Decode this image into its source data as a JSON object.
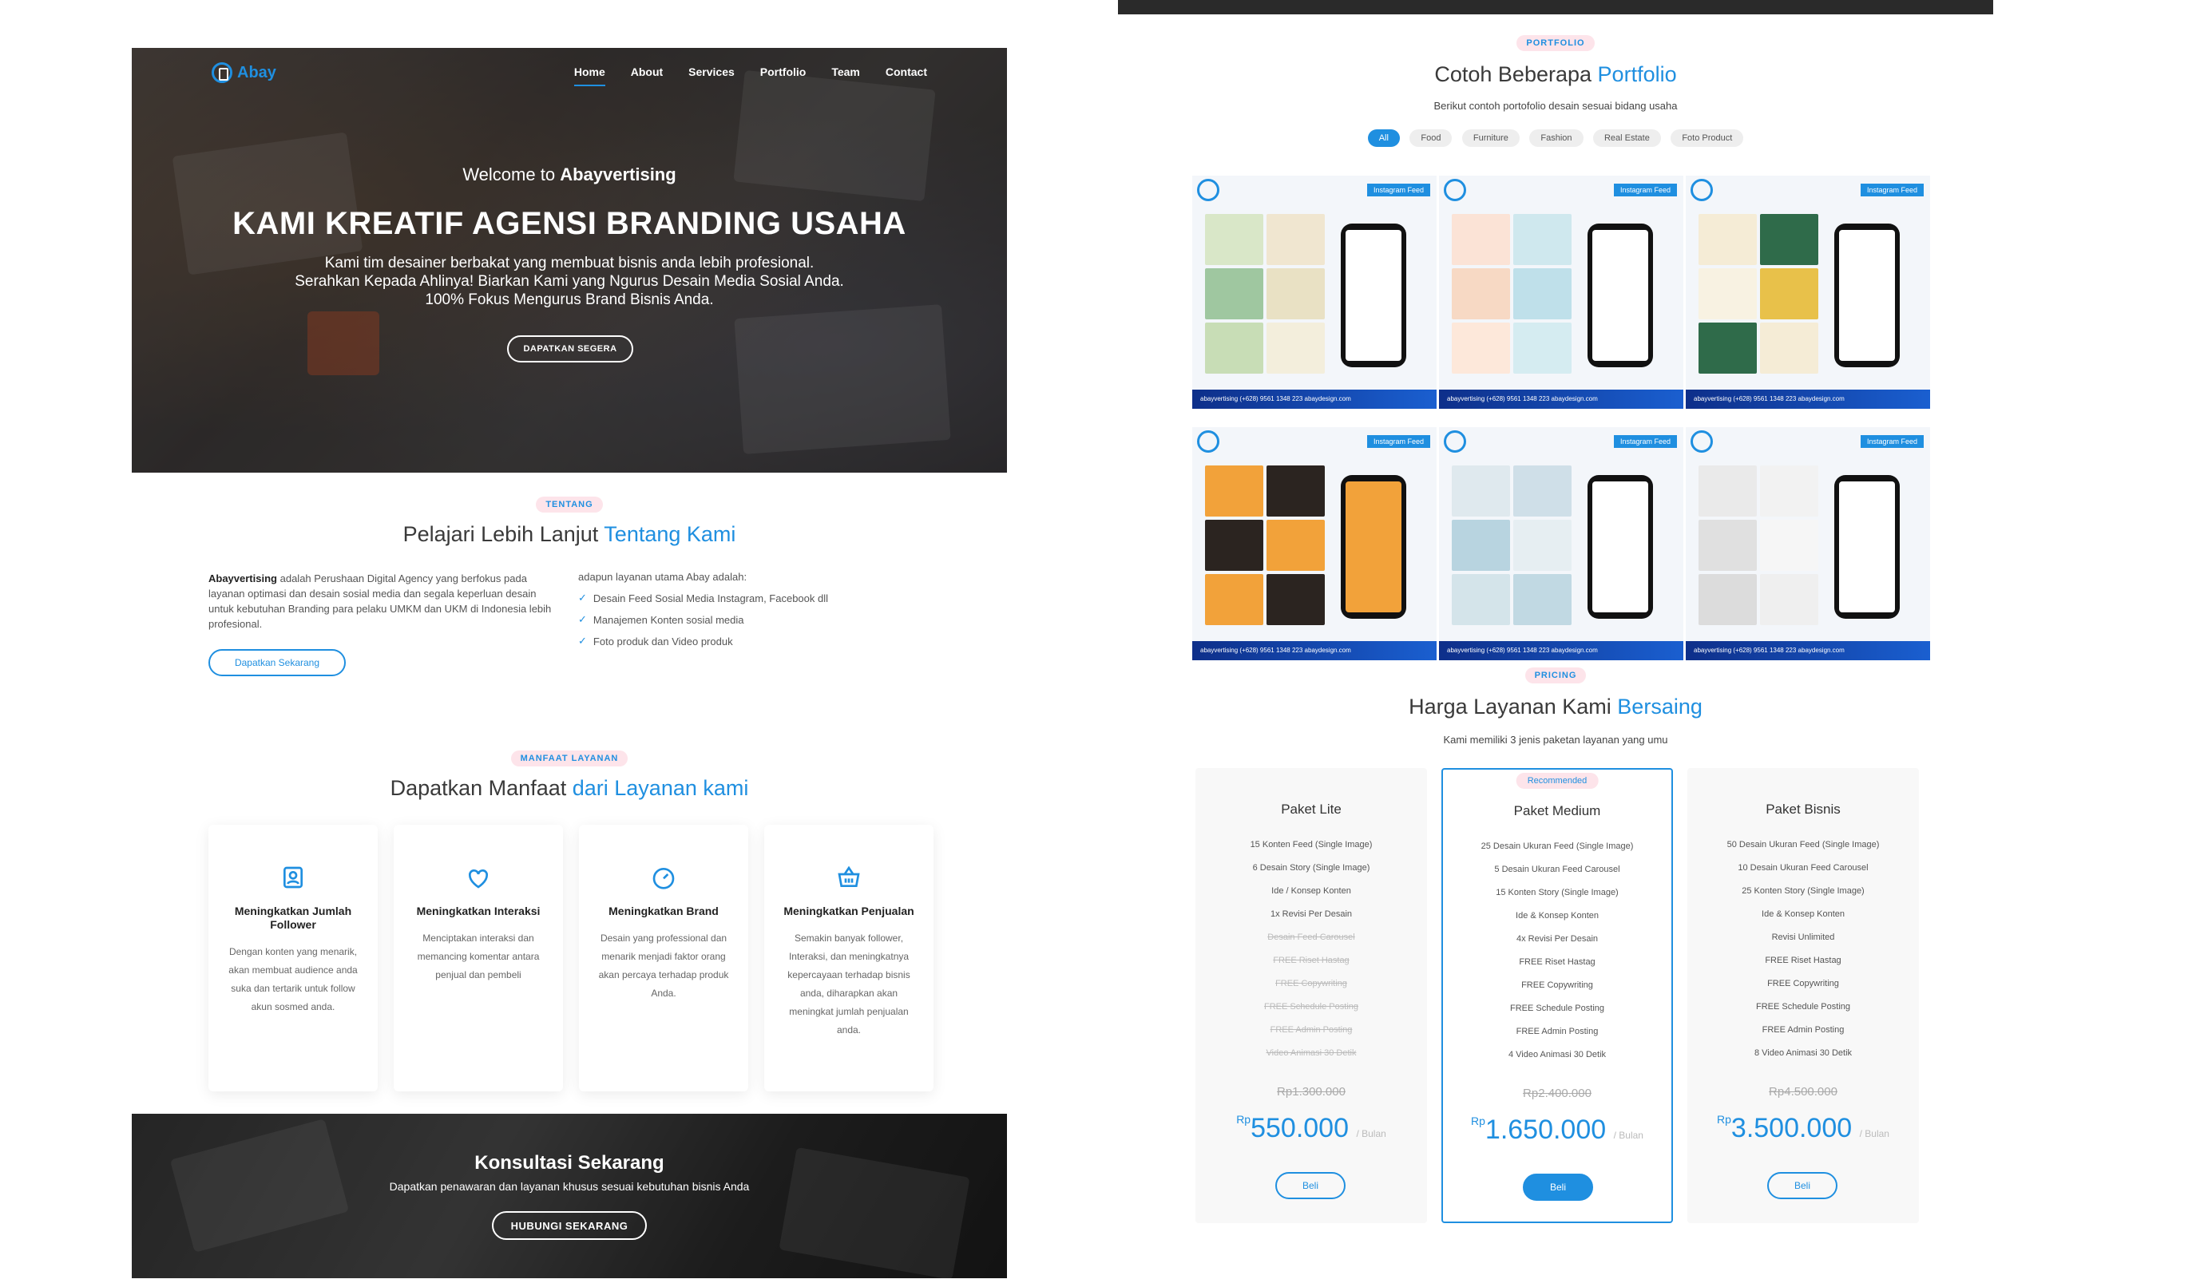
{
  "hero": {
    "logo": "Abay",
    "nav": [
      "Home",
      "About",
      "Services",
      "Portfolio",
      "Team",
      "Contact"
    ],
    "welcome_prefix": "Welcome to",
    "welcome_brand": "Abayvertising",
    "title": "KAMI KREATIF AGENSI BRANDING USAHA",
    "sub_1": "Kami tim desainer berbakat yang membuat bisnis anda lebih profesional.",
    "sub_2": "Serahkan Kepada Ahlinya! Biarkan Kami yang Ngurus Desain Media Sosial Anda.",
    "sub_3": "100% Fokus Mengurus Brand Bisnis Anda.",
    "cta": "DAPATKAN SEGERA"
  },
  "about": {
    "badge": "TENTANG",
    "title_plain": "Pelajari Lebih Lanjut",
    "title_hl": "Tentang Kami",
    "brand": "Abayvertising",
    "desc": "adalah Perushaan Digital Agency yang berfokus pada layanan optimasi dan desain sosial media dan segala keperluan desain untuk kebutuhan Branding para pelaku UMKM dan UKM di Indonesia lebih profesional.",
    "button": "Dapatkan Sekarang",
    "list_intro": "adapun layanan utama Abay adalah:",
    "list": [
      "Desain Feed Sosial Media Instagram, Facebook dll",
      "Manajemen Konten sosial media",
      "Foto produk dan Video produk"
    ]
  },
  "benefits": {
    "badge": "MANFAAT LAYANAN",
    "title_plain": "Dapatkan Manfaat",
    "title_hl": "dari Layanan kami",
    "cards": [
      {
        "title": "Meningkatkan Jumlah Follower",
        "text": "Dengan konten yang menarik, akan membuat audience anda suka dan tertarik untuk follow akun sosmed anda."
      },
      {
        "title": "Meningkatkan Interaksi",
        "text": "Menciptakan interaksi dan memancing komentar antara penjual dan pembeli"
      },
      {
        "title": "Meningkatkan Brand",
        "text": "Desain yang professional dan menarik menjadi faktor orang akan percaya terhadap produk Anda."
      },
      {
        "title": "Meningkatkan Penjualan",
        "text": "Semakin banyak follower, Interaksi, dan meningkatnya kepercayaan terhadap bisnis anda, diharapkan akan meningkat jumlah penjualan anda."
      }
    ]
  },
  "cta": {
    "title": "Konsultasi Sekarang",
    "sub": "Dapatkan penawaran dan layanan khusus sesuai kebutuhan bisnis Anda",
    "button": "HUBUNGI SEKARANG"
  },
  "portfolio": {
    "badge": "PORTFOLIO",
    "title_plain": "Cotoh Beberapa",
    "title_hl": "Portfolio",
    "sub": "Berikut contoh portofolio desain sesuai bidang usaha",
    "filters": [
      "All",
      "Food",
      "Furniture",
      "Fashion",
      "Real Estate",
      "Foto Product"
    ],
    "tag": "Instagram Feed",
    "footer": "abayvertising  (+628) 9561 1348 223  abaydesign.com"
  },
  "pricing": {
    "badge": "PRICING",
    "title_plain": "Harga Layanan Kami",
    "title_hl": "Bersaing",
    "sub": "Kami memiliki 3 jenis paketan layanan yang umu",
    "recommended": "Recommended",
    "currency": "Rp",
    "period": "/ Bulan",
    "buy": "Beli",
    "plans": [
      {
        "name": "Paket Lite",
        "features": [
          "15 Konten Feed (Single Image)",
          "6 Desain Story (Single Image)",
          "Ide / Konsep Konten",
          "1x Revisi Per Desain",
          "Desain Feed Carousel",
          "FREE Riset Hastag",
          "FREE Copywriting",
          "FREE Schedule Posting",
          "FREE Admin Posting",
          "Video Animasi 30 Detik"
        ],
        "old": "Rp1.300.000",
        "price": "550.000"
      },
      {
        "name": "Paket Medium",
        "features": [
          "25 Desain Ukuran Feed (Single Image)",
          "5 Desain Ukuran Feed Carousel",
          "15 Konten Story (Single Image)",
          "Ide & Konsep Konten",
          "4x Revisi Per Desain",
          "FREE Riset Hastag",
          "FREE Copywriting",
          "FREE Schedule Posting",
          "FREE Admin Posting",
          "4 Video Animasi 30 Detik"
        ],
        "old": "Rp2.400.000",
        "price": "1.650.000"
      },
      {
        "name": "Paket Bisnis",
        "features": [
          "50 Desain Ukuran Feed (Single Image)",
          "10 Desain Ukuran Feed Carousel",
          "25 Konten Story (Single Image)",
          "Ide & Konsep Konten",
          "Revisi Unlimited",
          "FREE Riset Hastag",
          "FREE Copywriting",
          "FREE Schedule Posting",
          "FREE Admin Posting",
          "8 Video Animasi 30 Detik"
        ],
        "old": "Rp4.500.000",
        "price": "3.500.000"
      }
    ]
  },
  "icons": {
    "follower": "user-badge-icon",
    "interaction": "heart-icon",
    "brand": "gauge-icon",
    "sales": "basket-icon",
    "check": "check-icon",
    "logo": "abay-logo-icon"
  },
  "colors": {
    "accent": "#1f8fe0",
    "badge_bg": "#fde4ea"
  }
}
